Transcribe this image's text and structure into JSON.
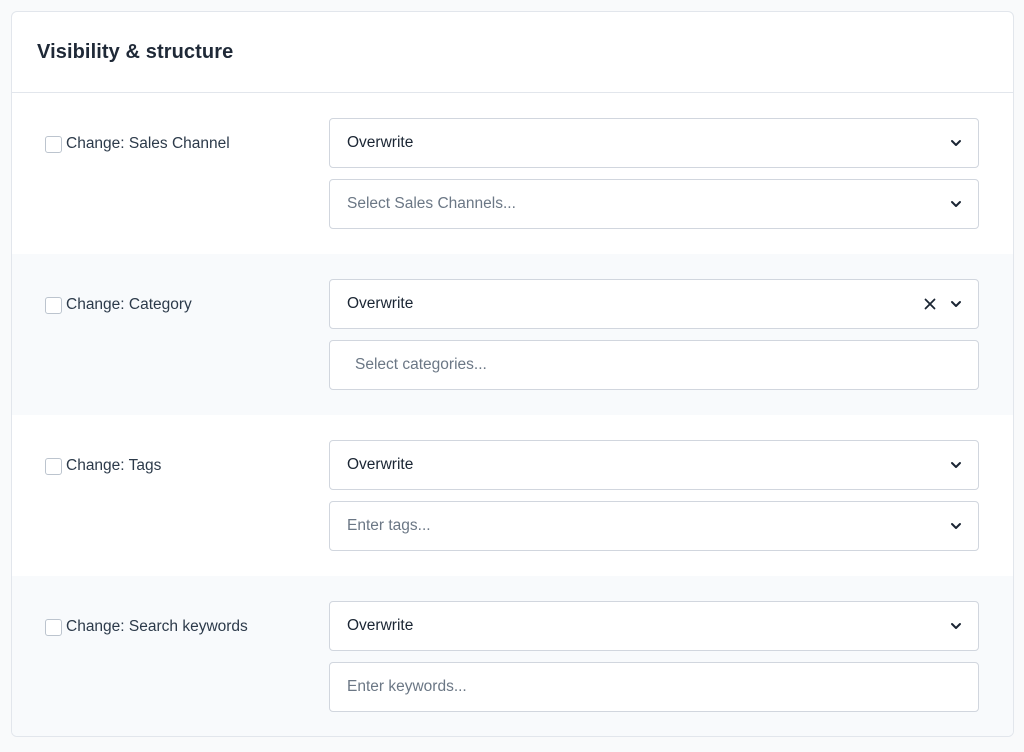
{
  "section": {
    "title": "Visibility & structure"
  },
  "rows": [
    {
      "label": "Change: Sales Channel",
      "mode": "Overwrite",
      "input_placeholder": "Select Sales Channels..."
    },
    {
      "label": "Change: Category",
      "mode": "Overwrite",
      "input_placeholder": "Select categories..."
    },
    {
      "label": "Change: Tags",
      "mode": "Overwrite",
      "input_placeholder": "Enter tags..."
    },
    {
      "label": "Change: Search keywords",
      "mode": "Overwrite",
      "input_placeholder": "Enter keywords..."
    }
  ],
  "icons": {
    "chevron": "chevron-down-icon",
    "clear": "close-icon"
  },
  "colors": {
    "border": "#d1d6de",
    "alt_row": "#f8fafc",
    "placeholder": "#6b7785"
  }
}
